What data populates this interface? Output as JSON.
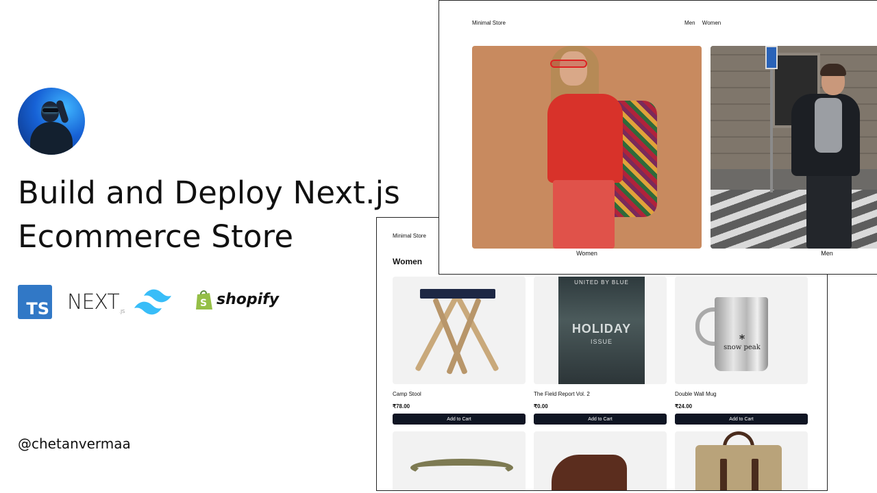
{
  "intro": {
    "headline_line1": "Build and Deploy Next.js",
    "headline_line2": "Ecommerce Store",
    "handle": "@chetanvermaa",
    "tech": {
      "typescript": "TS",
      "next": "NEXT",
      "next_suffix": ".JS",
      "shopify": "shopify"
    }
  },
  "shot_hero": {
    "brand": "Minimal Store",
    "nav": [
      "Men",
      "Women"
    ],
    "cards": [
      {
        "caption": "Women"
      },
      {
        "caption": "Men"
      }
    ]
  },
  "shot_products": {
    "brand": "Minimal Store",
    "section_title": "Women",
    "products": [
      {
        "name": "Camp Stool",
        "price": "₹78.00",
        "cta": "Add to Cart"
      },
      {
        "name": "The Field Report Vol. 2",
        "price": "₹0.00",
        "cta": "Add to Cart"
      },
      {
        "name": "Double Wall Mug",
        "price": "₹24.00",
        "cta": "Add to Cart"
      }
    ],
    "poster": {
      "line1": "UNITED BY BLUE",
      "line2": "HOLIDAY",
      "line3": "ISSUE"
    },
    "mug_logo": {
      "mark": "*",
      "text": "snow peak"
    }
  },
  "colors": {
    "ts_blue": "#3178c6",
    "tailwind_cyan": "#38bdf8",
    "shopify_green": "#95bf47",
    "button_dark": "#0f1523"
  }
}
